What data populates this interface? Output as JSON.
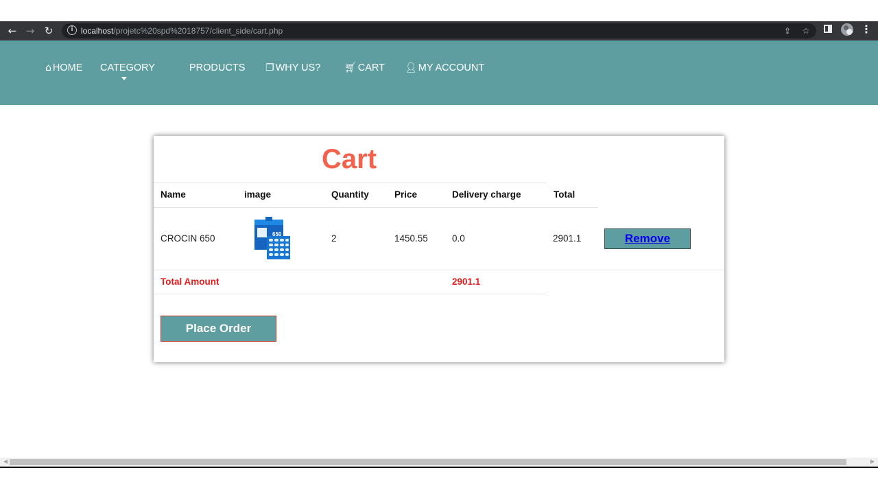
{
  "browser": {
    "url_host": "localhost",
    "url_path": "/projetc%20spd%2018757/client_side/cart.php",
    "back_icon": "arrow-left-icon",
    "forward_icon": "arrow-right-icon",
    "reload_icon": "reload-icon"
  },
  "nav": {
    "home": "HOME",
    "category": "CATEGORY",
    "products": "PRODUCTS",
    "why_us": "WHY US?",
    "cart": "CART",
    "my_account": "MY ACCOUNT",
    "bg_color": "#5f9ea0"
  },
  "cart": {
    "title": "Cart",
    "title_color": "#f2624d",
    "columns": [
      "Name",
      "image",
      "Quantity",
      "Price",
      "Delivery charge",
      "Total"
    ],
    "items": [
      {
        "name": "CROCIN 650",
        "image_label": "650",
        "quantity": "2",
        "price": "1450.55",
        "delivery_charge": "0.0",
        "total": "2901.1",
        "remove_label": "Remove"
      }
    ],
    "total_amount_label": "Total Amount",
    "total_amount_value": "2901.1",
    "total_color": "#e01e1e",
    "place_order_label": "Place Order"
  }
}
